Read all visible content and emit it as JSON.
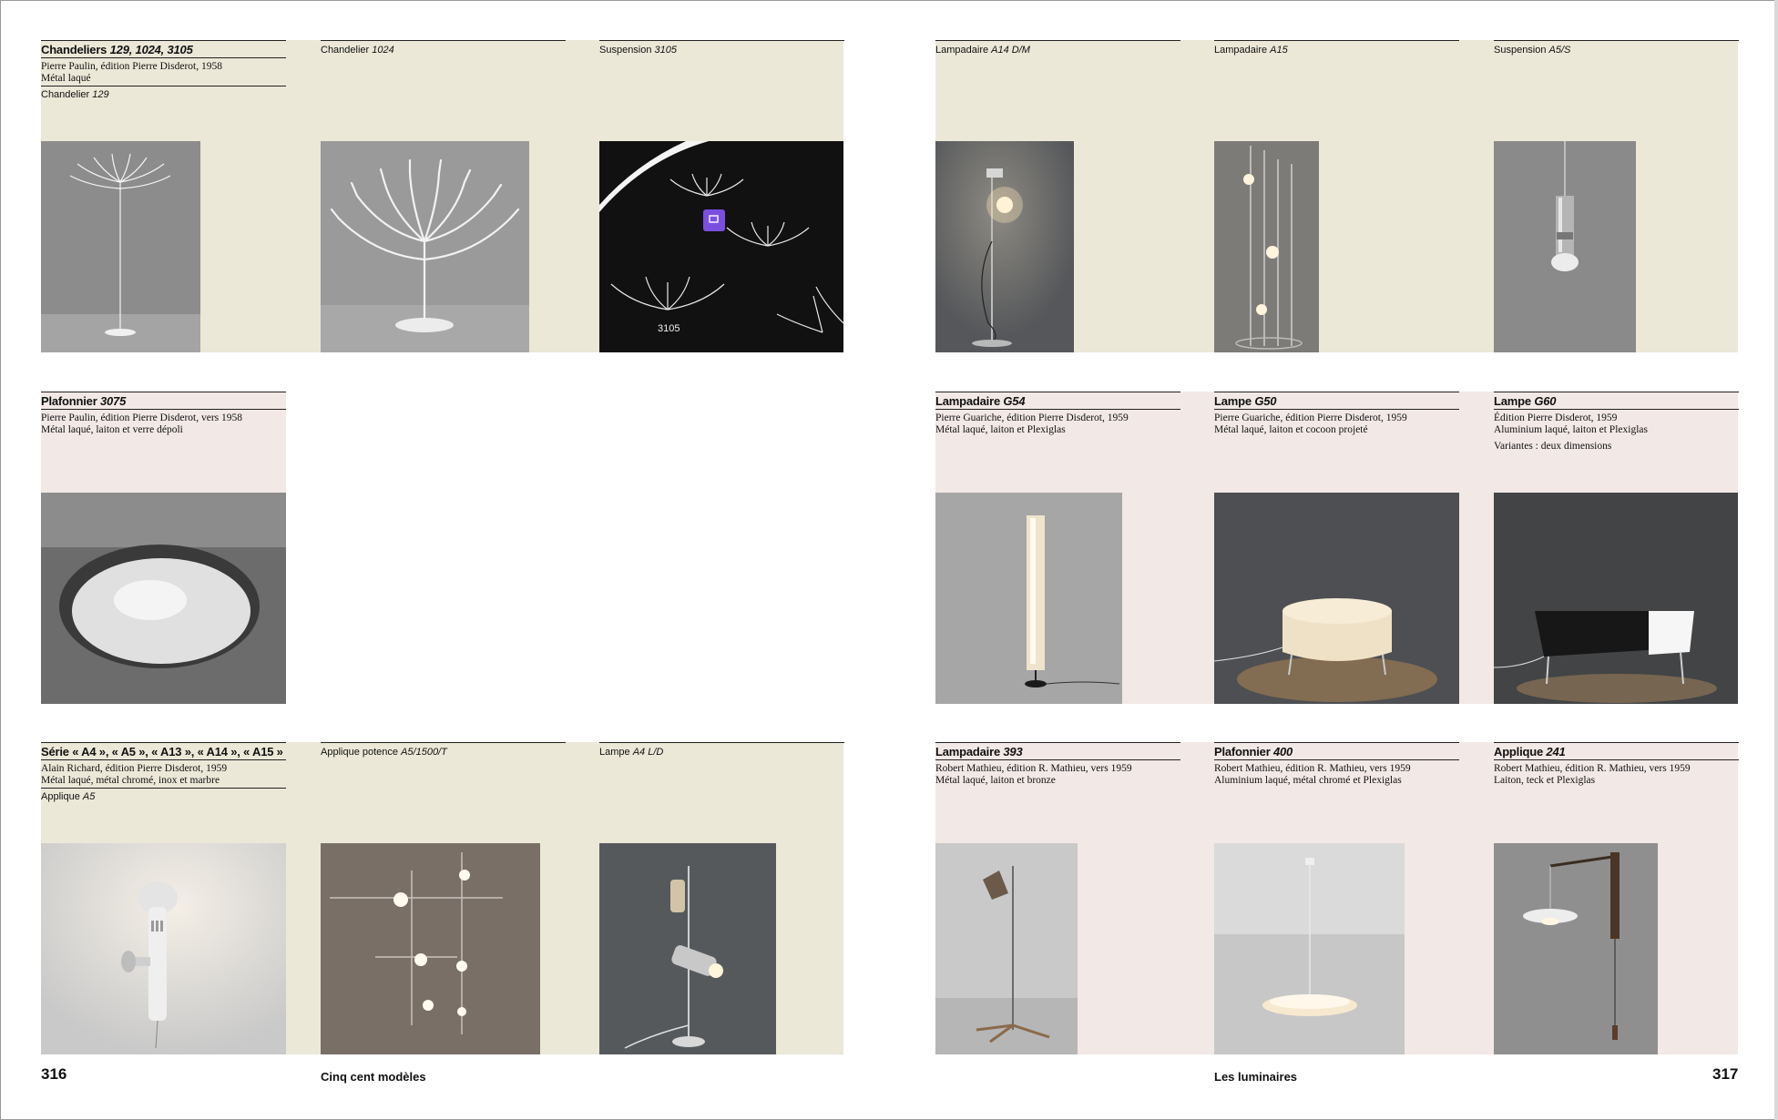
{
  "page_left": {
    "number": "316",
    "running_title": "Cinq cent modèles"
  },
  "page_right": {
    "number": "317",
    "running_title": "Les luminaires"
  },
  "items": {
    "chandeliers": {
      "title_pre": "Chandeliers ",
      "title_models": "129, 1024, 3105",
      "line1": "Pierre Paulin, édition Pierre Disderot, 1958",
      "line2": "Métal laqué",
      "sub_pre": "Chandelier ",
      "sub_model": "129"
    },
    "chandelier_1024": {
      "label_pre": "Chandelier ",
      "label_model": "1024"
    },
    "suspension_3105": {
      "label_pre": "Suspension ",
      "label_model": "3105",
      "photo_caption": "3105"
    },
    "lampadaire_a14": {
      "label_pre": "Lampadaire ",
      "label_model": "A14 D/M"
    },
    "lampadaire_a15": {
      "label_pre": "Lampadaire ",
      "label_model": "A15"
    },
    "suspension_a5s": {
      "label_pre": "Suspension ",
      "label_model": "A5/S"
    },
    "plafonnier_3075": {
      "title_pre": "Plafonnier ",
      "title_models": "3075",
      "line1": "Pierre Paulin, édition Pierre Disderot, vers 1958",
      "line2": "Métal laqué, laiton et verre dépoli"
    },
    "lampadaire_g54": {
      "title_pre": "Lampadaire ",
      "title_models": "G54",
      "line1": "Pierre Guariche, édition Pierre Disderot, 1959",
      "line2": "Métal laqué, laiton et Plexiglas"
    },
    "lampe_g50": {
      "title_pre": "Lampe ",
      "title_models": "G50",
      "line1": "Pierre Guariche, édition Pierre Disderot, 1959",
      "line2": "Métal laqué, laiton et cocoon projeté"
    },
    "lampe_g60": {
      "title_pre": "Lampe ",
      "title_models": "G60",
      "line1": "Édition Pierre Disderot, 1959",
      "line2": "Aluminium laqué, laiton et Plexiglas",
      "note": "Variantes : deux dimensions"
    },
    "serie_a": {
      "title_full": "Série « A4 », « A5 », « A13 », « A14 », « A15 »",
      "line1": "Alain Richard, édition Pierre Disderot, 1959",
      "line2": "Métal laqué, métal chromé, inox et marbre",
      "sub_pre": "Applique ",
      "sub_model": "A5"
    },
    "applique_a5_1500": {
      "label_pre": "Applique potence ",
      "label_model": "A5/1500/T"
    },
    "lampe_a4": {
      "label_pre": "Lampe ",
      "label_model": "A4 L/D"
    },
    "lampadaire_393": {
      "title_pre": "Lampadaire ",
      "title_models": "393",
      "line1": "Robert Mathieu, édition R. Mathieu, vers 1959",
      "line2": "Métal laqué, laiton et bronze"
    },
    "plafonnier_400": {
      "title_pre": "Plafonnier ",
      "title_models": "400",
      "line1": "Robert Mathieu, édition R. Mathieu, vers 1959",
      "line2": "Aluminium laqué, métal chromé et Plexiglas"
    },
    "applique_241": {
      "title_pre": "Applique ",
      "title_models": "241",
      "line1": "Robert Mathieu, édition R. Mathieu, vers 1959",
      "line2": "Laiton, teck et Plexiglas"
    }
  },
  "colors": {
    "cream_band": "#ebe8d8",
    "pink_band": "#f2e8e6",
    "rule": "#222222"
  },
  "icons": {
    "overlay_badge": "image-icon"
  }
}
